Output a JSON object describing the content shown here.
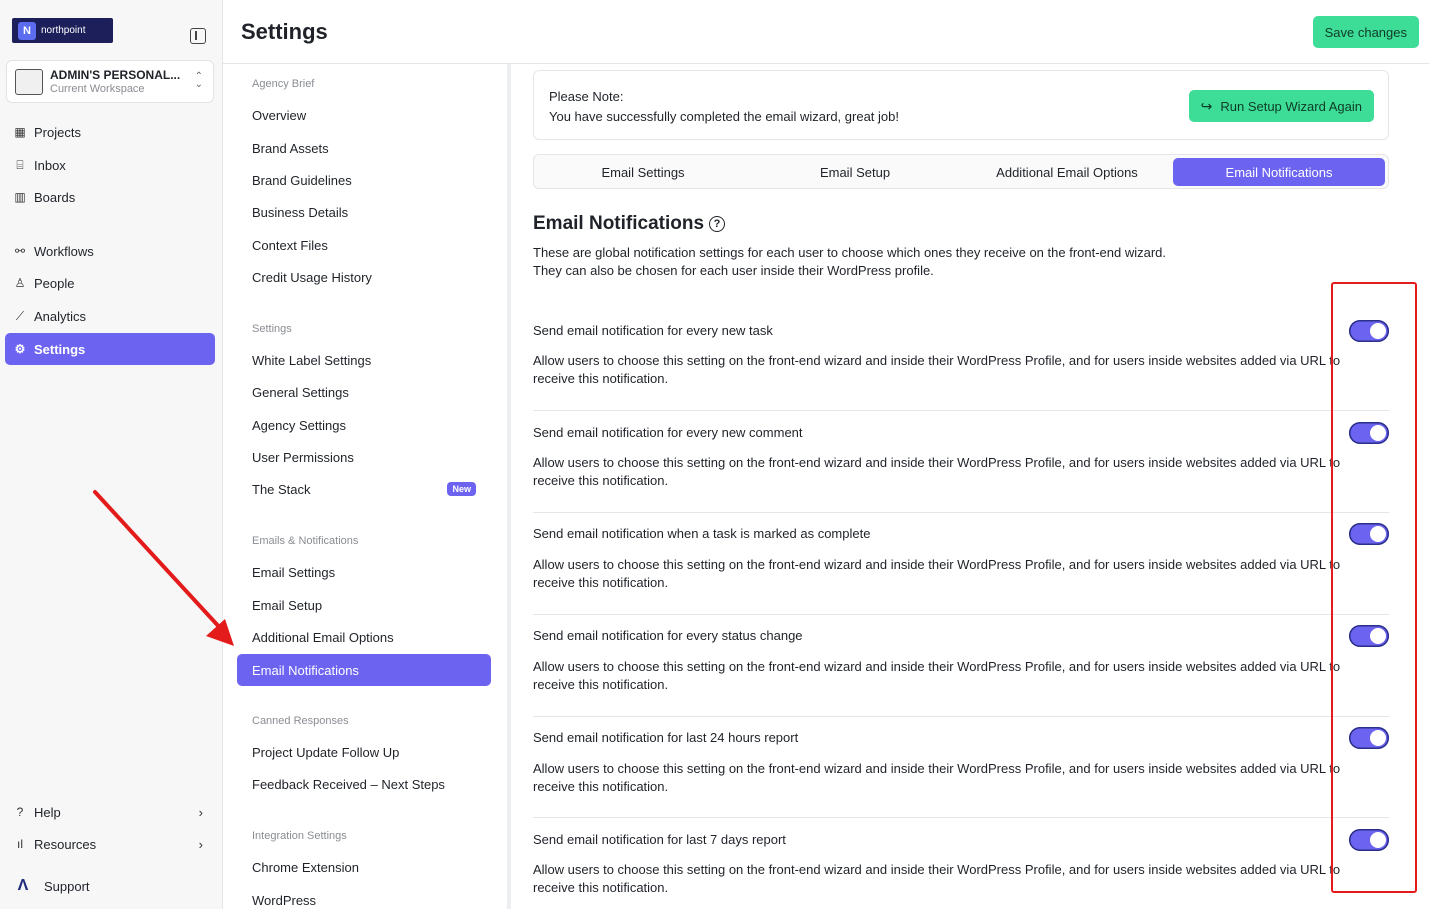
{
  "app": {
    "logo_text": "northpoint",
    "logo_mark": "N",
    "logo_icon": "northpoint-logo"
  },
  "workspace": {
    "name": "ADMIN'S PERSONAL...",
    "subtitle": "Current Workspace"
  },
  "nav": {
    "items": [
      {
        "label": "Projects",
        "icon": "grid-icon"
      },
      {
        "label": "Inbox",
        "icon": "inbox-icon"
      },
      {
        "label": "Boards",
        "icon": "board-icon"
      },
      {
        "label": "Workflows",
        "icon": "workflow-icon"
      },
      {
        "label": "People",
        "icon": "person-icon"
      },
      {
        "label": "Analytics",
        "icon": "chart-icon"
      },
      {
        "label": "Settings",
        "icon": "gear-icon",
        "active": true
      }
    ],
    "bottom": [
      {
        "label": "Help",
        "icon": "help-icon"
      },
      {
        "label": "Resources",
        "icon": "bar-chart-icon"
      },
      {
        "label": "Support",
        "icon": "support-logo"
      }
    ]
  },
  "header": {
    "title": "Settings",
    "save_label": "Save changes"
  },
  "subnav": {
    "groups": [
      {
        "heading": "Agency Brief",
        "items": [
          "Overview",
          "Brand Assets",
          "Brand Guidelines",
          "Business Details",
          "Context Files",
          "Credit Usage History"
        ]
      },
      {
        "heading": "Settings",
        "items": [
          "White Label Settings",
          "General Settings",
          "Agency Settings",
          "User Permissions",
          "The Stack"
        ]
      },
      {
        "heading": "Emails & Notifications",
        "items": [
          "Email Settings",
          "Email Setup",
          "Additional Email Options",
          "Email Notifications"
        ]
      },
      {
        "heading": "Canned Responses",
        "items": [
          "Project Update Follow Up",
          "Feedback Received – Next Steps"
        ]
      },
      {
        "heading": "Integration Settings",
        "items": [
          "Chrome Extension",
          "WordPress"
        ]
      }
    ],
    "new_badge": "New",
    "active_item": "Email Notifications"
  },
  "note": {
    "title": "Please Note:",
    "text": "You have successfully completed the email wizard, great job!",
    "button_label": "Run Setup Wizard Again"
  },
  "tabs": [
    "Email Settings",
    "Email Setup",
    "Additional Email Options",
    "Email Notifications"
  ],
  "active_tab": "Email Notifications",
  "section": {
    "title": "Email Notifications",
    "desc_line1": "These are global notification settings for each user to choose which ones they receive on the front-end wizard.",
    "desc_line2": "They can also be chosen for each user inside their WordPress profile."
  },
  "notifications": [
    {
      "title": "Send email notification for every new task",
      "enabled": true
    },
    {
      "title": "Send email notification for every new comment",
      "enabled": true
    },
    {
      "title": "Send email notification when a task is marked as complete",
      "enabled": true
    },
    {
      "title": "Send email notification for every status change",
      "enabled": true
    },
    {
      "title": "Send email notification for last 24 hours report",
      "enabled": true
    },
    {
      "title": "Send email notification for last 7 days report",
      "enabled": true
    }
  ],
  "notification_desc": "Allow users to choose this setting on the front-end wizard and inside their WordPress Profile, and for users inside websites added via URL to receive this notification.",
  "colors": {
    "accent": "#6c63f0",
    "save_green": "#3ddc97",
    "annotation_red": "#e31b1b"
  }
}
